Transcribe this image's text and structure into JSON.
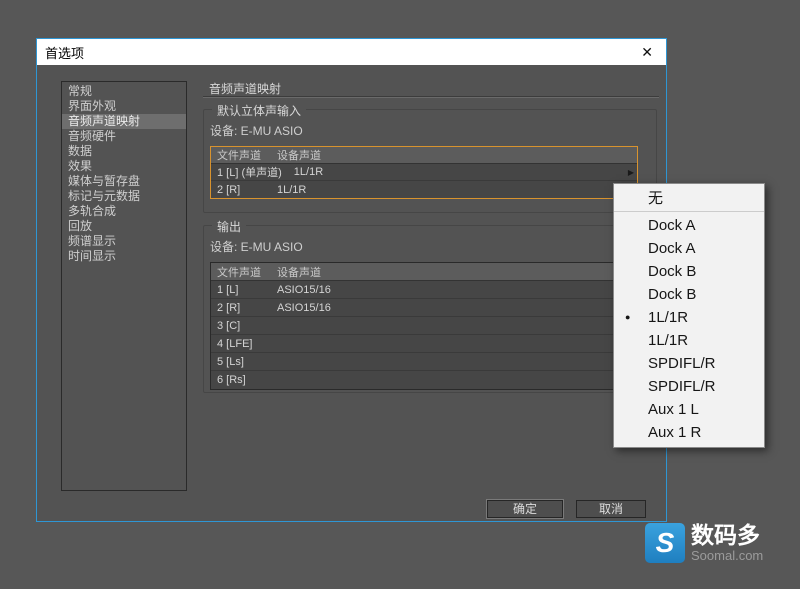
{
  "window": {
    "title": "首选项"
  },
  "icons": {
    "close": "✕",
    "arrow": "▶",
    "bullet": "●",
    "logo": "S"
  },
  "sidebar": {
    "items": [
      {
        "label": "常规",
        "selected": false
      },
      {
        "label": "界面外观",
        "selected": false
      },
      {
        "label": "音频声道映射",
        "selected": true
      },
      {
        "label": "音频硬件",
        "selected": false
      },
      {
        "label": "数据",
        "selected": false
      },
      {
        "label": "效果",
        "selected": false
      },
      {
        "label": "媒体与暂存盘",
        "selected": false
      },
      {
        "label": "标记与元数据",
        "selected": false
      },
      {
        "label": "多轨合成",
        "selected": false
      },
      {
        "label": "回放",
        "selected": false
      },
      {
        "label": "频谱显示",
        "selected": false
      },
      {
        "label": "时间显示",
        "selected": false
      }
    ]
  },
  "main": {
    "title": "音频声道映射",
    "input_section": {
      "title": "默认立体声输入",
      "device_label": "设备: E-MU ASIO",
      "table": {
        "headers": [
          "文件声道",
          "设备声道"
        ],
        "rows": [
          {
            "file": "1 [L] (单声道)",
            "device": "1L/1R"
          },
          {
            "file": "2 [R]",
            "device": "1L/1R"
          }
        ]
      }
    },
    "output_section": {
      "title": "输出",
      "device_label": "设备: E-MU ASIO",
      "table": {
        "headers": [
          "文件声道",
          "设备声道"
        ],
        "rows": [
          {
            "file": "1 [L]",
            "device": "ASIO15/16"
          },
          {
            "file": "2 [R]",
            "device": "ASIO15/16"
          },
          {
            "file": "3 [C]",
            "device": ""
          },
          {
            "file": "4 [LFE]",
            "device": ""
          },
          {
            "file": "5 [Ls]",
            "device": ""
          },
          {
            "file": "6 [Rs]",
            "device": ""
          }
        ]
      }
    },
    "buttons": {
      "ok": "确定",
      "cancel": "取消"
    }
  },
  "popup": {
    "items": [
      {
        "label": "无",
        "selected": false,
        "separator_after": true
      },
      {
        "label": "Dock A",
        "selected": false,
        "separator_after": false
      },
      {
        "label": "Dock A",
        "selected": false,
        "separator_after": false
      },
      {
        "label": "Dock B",
        "selected": false,
        "separator_after": false
      },
      {
        "label": "Dock B",
        "selected": false,
        "separator_after": false
      },
      {
        "label": "1L/1R",
        "selected": true,
        "separator_after": false
      },
      {
        "label": "1L/1R",
        "selected": false,
        "separator_after": false
      },
      {
        "label": "SPDIFL/R",
        "selected": false,
        "separator_after": false
      },
      {
        "label": "SPDIFL/R",
        "selected": false,
        "separator_after": false
      },
      {
        "label": "Aux 1 L",
        "selected": false,
        "separator_after": false
      },
      {
        "label": "Aux 1 R",
        "selected": false,
        "separator_after": false
      }
    ]
  },
  "watermark": {
    "brand": "数码多",
    "site": "Soomal.com"
  }
}
